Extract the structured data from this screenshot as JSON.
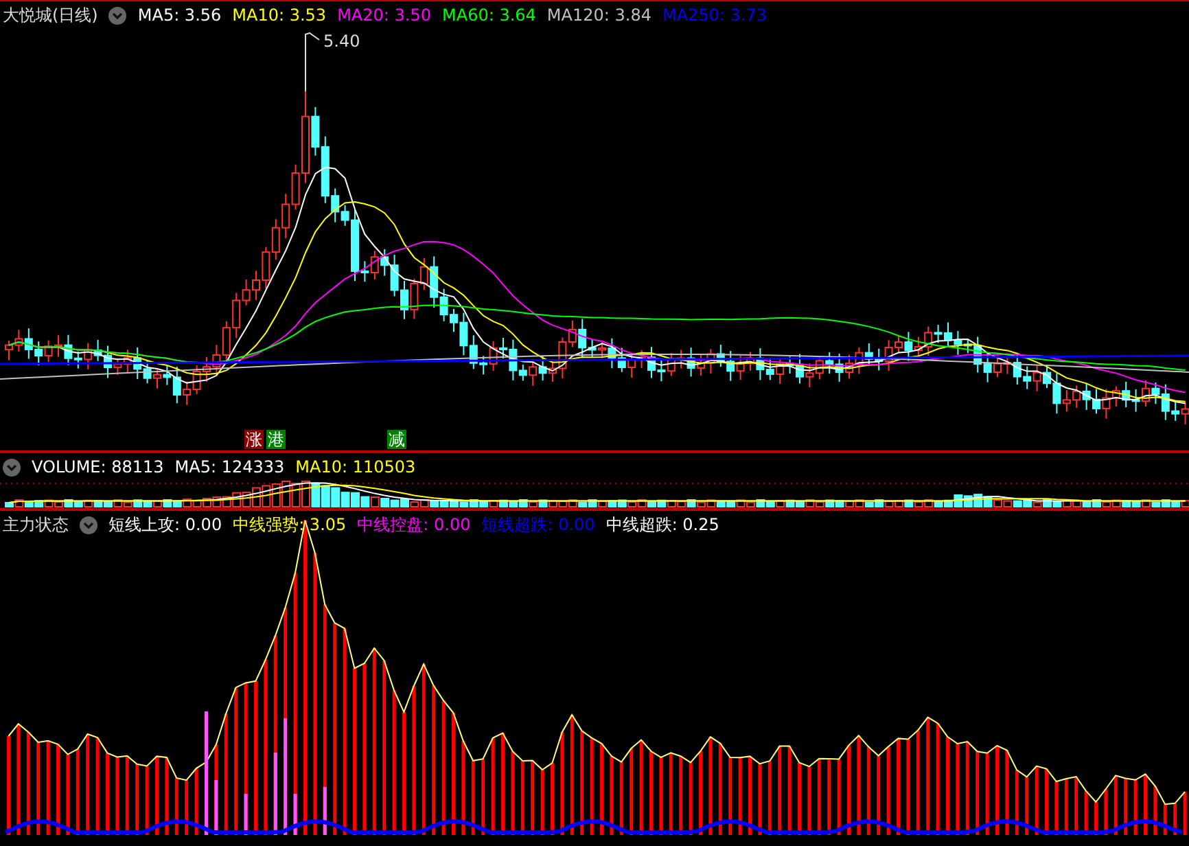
{
  "price_panel": {
    "title": "大悦城(日线)",
    "ma_legend": [
      {
        "label": "MA5: 3.56",
        "color": "#ffffff"
      },
      {
        "label": "MA10: 3.53",
        "color": "#ffff00"
      },
      {
        "label": "MA20: 3.50",
        "color": "#ff00ff"
      },
      {
        "label": "MA60: 3.64",
        "color": "#00ff00"
      },
      {
        "label": "MA120: 3.84",
        "color": "#c0c0c0"
      },
      {
        "label": "MA250: 3.73",
        "color": "#0000ff"
      }
    ],
    "high_label": "5.40",
    "markers": [
      {
        "text": "涨",
        "color": "#8b0000"
      },
      {
        "text": "港",
        "color": "#008000"
      },
      {
        "text": "减",
        "color": "#008000"
      }
    ]
  },
  "volume_panel": {
    "legend": [
      {
        "label": "VOLUME: 88113",
        "color": "#ffffff"
      },
      {
        "label": "MA5: 124333",
        "color": "#ffffff"
      },
      {
        "label": "MA10: 110503",
        "color": "#ffff00"
      }
    ]
  },
  "indicator_panel": {
    "title": "主力状态",
    "legend": [
      {
        "label": "短线上攻: 0.00",
        "color": "#ffffff"
      },
      {
        "label": "中线强势: 3.05",
        "color": "#ffff00"
      },
      {
        "label": "中线控盘: 0.00",
        "color": "#ff00ff"
      },
      {
        "label": "短线超跌: 0.00",
        "color": "#0000ff"
      },
      {
        "label": "中线超跌: 0.25",
        "color": "#ffffff"
      }
    ]
  }
}
